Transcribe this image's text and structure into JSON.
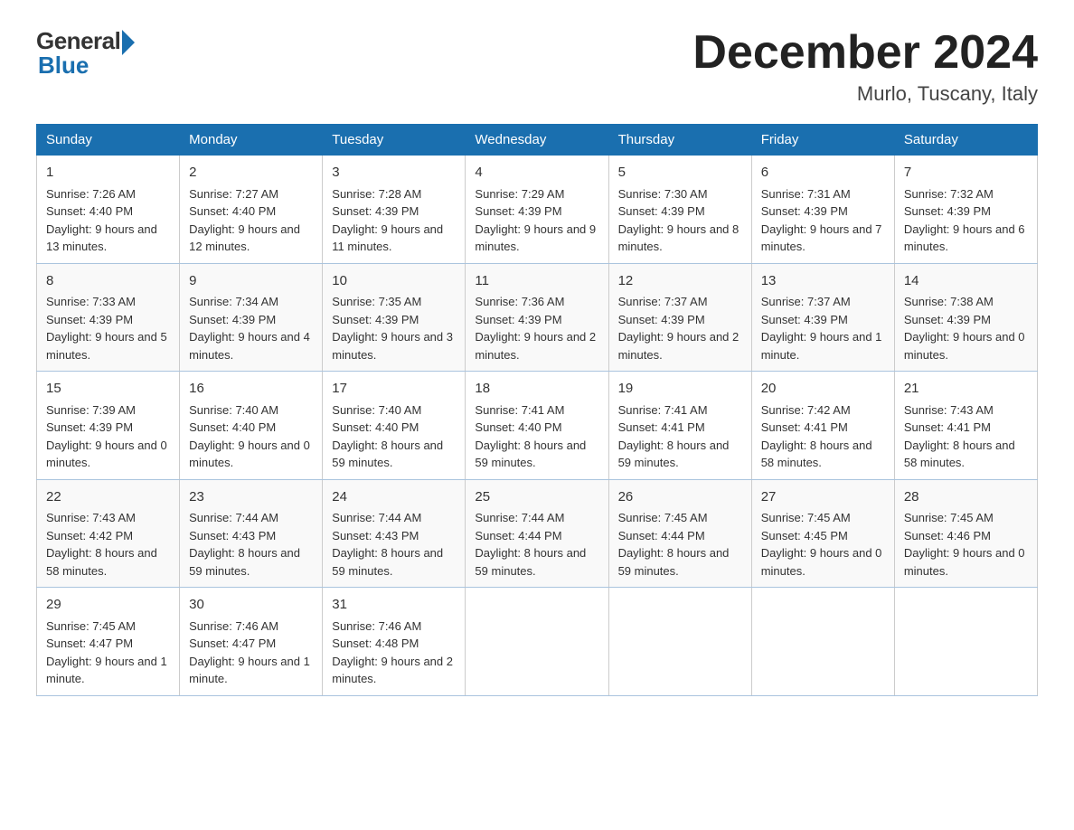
{
  "header": {
    "logo_general": "General",
    "logo_blue": "Blue",
    "month_title": "December 2024",
    "location": "Murlo, Tuscany, Italy"
  },
  "days_of_week": [
    "Sunday",
    "Monday",
    "Tuesday",
    "Wednesday",
    "Thursday",
    "Friday",
    "Saturday"
  ],
  "weeks": [
    [
      {
        "day": "1",
        "sunrise": "7:26 AM",
        "sunset": "4:40 PM",
        "daylight": "9 hours and 13 minutes."
      },
      {
        "day": "2",
        "sunrise": "7:27 AM",
        "sunset": "4:40 PM",
        "daylight": "9 hours and 12 minutes."
      },
      {
        "day": "3",
        "sunrise": "7:28 AM",
        "sunset": "4:39 PM",
        "daylight": "9 hours and 11 minutes."
      },
      {
        "day": "4",
        "sunrise": "7:29 AM",
        "sunset": "4:39 PM",
        "daylight": "9 hours and 9 minutes."
      },
      {
        "day": "5",
        "sunrise": "7:30 AM",
        "sunset": "4:39 PM",
        "daylight": "9 hours and 8 minutes."
      },
      {
        "day": "6",
        "sunrise": "7:31 AM",
        "sunset": "4:39 PM",
        "daylight": "9 hours and 7 minutes."
      },
      {
        "day": "7",
        "sunrise": "7:32 AM",
        "sunset": "4:39 PM",
        "daylight": "9 hours and 6 minutes."
      }
    ],
    [
      {
        "day": "8",
        "sunrise": "7:33 AM",
        "sunset": "4:39 PM",
        "daylight": "9 hours and 5 minutes."
      },
      {
        "day": "9",
        "sunrise": "7:34 AM",
        "sunset": "4:39 PM",
        "daylight": "9 hours and 4 minutes."
      },
      {
        "day": "10",
        "sunrise": "7:35 AM",
        "sunset": "4:39 PM",
        "daylight": "9 hours and 3 minutes."
      },
      {
        "day": "11",
        "sunrise": "7:36 AM",
        "sunset": "4:39 PM",
        "daylight": "9 hours and 2 minutes."
      },
      {
        "day": "12",
        "sunrise": "7:37 AM",
        "sunset": "4:39 PM",
        "daylight": "9 hours and 2 minutes."
      },
      {
        "day": "13",
        "sunrise": "7:37 AM",
        "sunset": "4:39 PM",
        "daylight": "9 hours and 1 minute."
      },
      {
        "day": "14",
        "sunrise": "7:38 AM",
        "sunset": "4:39 PM",
        "daylight": "9 hours and 0 minutes."
      }
    ],
    [
      {
        "day": "15",
        "sunrise": "7:39 AM",
        "sunset": "4:39 PM",
        "daylight": "9 hours and 0 minutes."
      },
      {
        "day": "16",
        "sunrise": "7:40 AM",
        "sunset": "4:40 PM",
        "daylight": "9 hours and 0 minutes."
      },
      {
        "day": "17",
        "sunrise": "7:40 AM",
        "sunset": "4:40 PM",
        "daylight": "8 hours and 59 minutes."
      },
      {
        "day": "18",
        "sunrise": "7:41 AM",
        "sunset": "4:40 PM",
        "daylight": "8 hours and 59 minutes."
      },
      {
        "day": "19",
        "sunrise": "7:41 AM",
        "sunset": "4:41 PM",
        "daylight": "8 hours and 59 minutes."
      },
      {
        "day": "20",
        "sunrise": "7:42 AM",
        "sunset": "4:41 PM",
        "daylight": "8 hours and 58 minutes."
      },
      {
        "day": "21",
        "sunrise": "7:43 AM",
        "sunset": "4:41 PM",
        "daylight": "8 hours and 58 minutes."
      }
    ],
    [
      {
        "day": "22",
        "sunrise": "7:43 AM",
        "sunset": "4:42 PM",
        "daylight": "8 hours and 58 minutes."
      },
      {
        "day": "23",
        "sunrise": "7:44 AM",
        "sunset": "4:43 PM",
        "daylight": "8 hours and 59 minutes."
      },
      {
        "day": "24",
        "sunrise": "7:44 AM",
        "sunset": "4:43 PM",
        "daylight": "8 hours and 59 minutes."
      },
      {
        "day": "25",
        "sunrise": "7:44 AM",
        "sunset": "4:44 PM",
        "daylight": "8 hours and 59 minutes."
      },
      {
        "day": "26",
        "sunrise": "7:45 AM",
        "sunset": "4:44 PM",
        "daylight": "8 hours and 59 minutes."
      },
      {
        "day": "27",
        "sunrise": "7:45 AM",
        "sunset": "4:45 PM",
        "daylight": "9 hours and 0 minutes."
      },
      {
        "day": "28",
        "sunrise": "7:45 AM",
        "sunset": "4:46 PM",
        "daylight": "9 hours and 0 minutes."
      }
    ],
    [
      {
        "day": "29",
        "sunrise": "7:45 AM",
        "sunset": "4:47 PM",
        "daylight": "9 hours and 1 minute."
      },
      {
        "day": "30",
        "sunrise": "7:46 AM",
        "sunset": "4:47 PM",
        "daylight": "9 hours and 1 minute."
      },
      {
        "day": "31",
        "sunrise": "7:46 AM",
        "sunset": "4:48 PM",
        "daylight": "9 hours and 2 minutes."
      },
      null,
      null,
      null,
      null
    ]
  ],
  "labels": {
    "sunrise": "Sunrise:",
    "sunset": "Sunset:",
    "daylight": "Daylight:"
  }
}
